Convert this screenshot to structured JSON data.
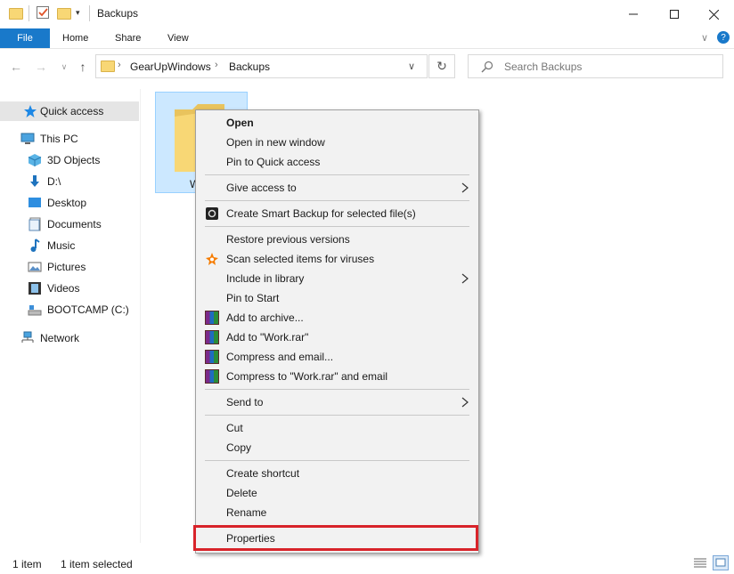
{
  "window": {
    "title": "Backups"
  },
  "ribbon": {
    "tabs": [
      "File",
      "Home",
      "Share",
      "View"
    ]
  },
  "address": {
    "path": [
      "GearUpWindows",
      "Backups"
    ]
  },
  "search": {
    "placeholder": "Search Backups"
  },
  "nav_pane": {
    "items": [
      "Quick access",
      "This PC",
      "3D Objects",
      "D:\\",
      "Desktop",
      "Documents",
      "Music",
      "Pictures",
      "Videos",
      "BOOTCAMP (C:)",
      "Network"
    ],
    "selected": "Quick access"
  },
  "content": {
    "folder_label_visible": "W"
  },
  "status_bar": {
    "count": "1 item",
    "selection": "1 item selected"
  },
  "context_menu": {
    "items": [
      "Open",
      "Open in new window",
      "Pin to Quick access",
      "Give access to",
      "Create Smart Backup for selected file(s)",
      "Restore previous versions",
      "Scan selected items for viruses",
      "Include in library",
      "Pin to Start",
      "Add to archive...",
      "Add to \"Work.rar\"",
      "Compress and email...",
      "Compress to \"Work.rar\" and email",
      "Send to",
      "Cut",
      "Copy",
      "Create shortcut",
      "Delete",
      "Rename",
      "Properties"
    ],
    "highlighted": "Properties"
  },
  "colors": {
    "accent": "#1979ca",
    "highlight_box": "#d8232a",
    "selection": "#cce8ff",
    "folder": "#f8d775"
  }
}
